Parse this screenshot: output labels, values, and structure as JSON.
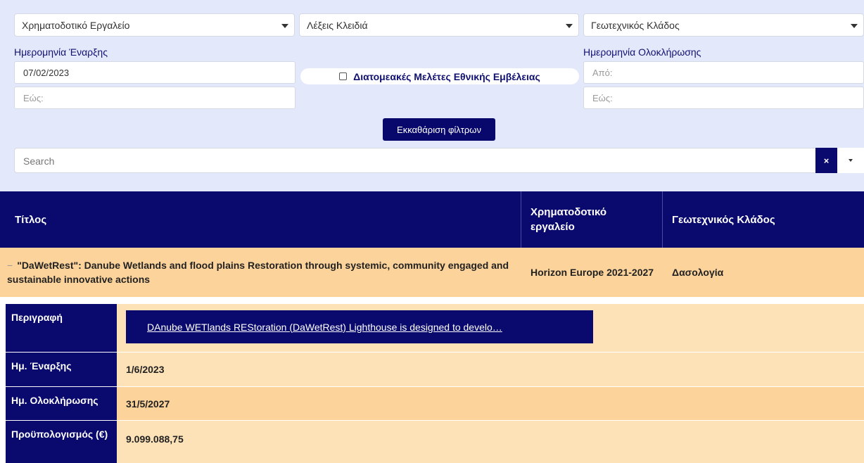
{
  "filters": {
    "funding_tool": {
      "value": "Χρηματοδοτικό Εργαλείο"
    },
    "keywords": {
      "value": "Λέξεις Κλειδιά"
    },
    "geotech_branch": {
      "value": "Γεωτεχνικός Κλάδος"
    },
    "start_date_label": "Ημερομηνία Έναρξης",
    "start_from_value": "07/02/2023",
    "start_to_placeholder": "Εώς:",
    "end_date_label": "Ημερομηνία Ολοκλήρωσης",
    "end_from_placeholder": "Από:",
    "end_to_placeholder": "Εώς:",
    "cross_sector_label": "Διατομεακές Μελέτες Εθνικής Εμβέλειας",
    "cross_sector_checked": false,
    "clear_button": "Εκκαθάριση φίλτρων",
    "search_placeholder": "Search",
    "search_clear_icon": "×"
  },
  "table": {
    "headers": {
      "title": "Τίτλος",
      "funding": "Χρηματοδοτικό εργαλείο",
      "branch": "Γεωτεχνικός Κλάδος"
    },
    "rows": [
      {
        "toggle": "−",
        "title": "\"DaWetRest\": Danube Wetlands and flood plains Restoration through systemic, community engaged and sustainable innovative actions",
        "funding": "Horizon Europe 2021-2027",
        "branch": "Δασολογία"
      }
    ],
    "detail": {
      "description_label": "Περιγραφή",
      "description_link": "DAnube WETlands REStoration (DaWetRest) Lighthouse is designed to develo…",
      "start_label": "Ημ. Έναρξης",
      "start_value": "1/6/2023",
      "end_label": "Ημ. Ολοκλήρωσης",
      "end_value": "31/5/2027",
      "budget_label": "Προϋπολογισμός (€)",
      "budget_value": "9.099.088,75"
    }
  },
  "colors": {
    "navy": "#0a0a6e",
    "filter_bg": "#e3e9fb",
    "row_bg": "#fcd39a",
    "detail_bg": "#fde2b8"
  }
}
